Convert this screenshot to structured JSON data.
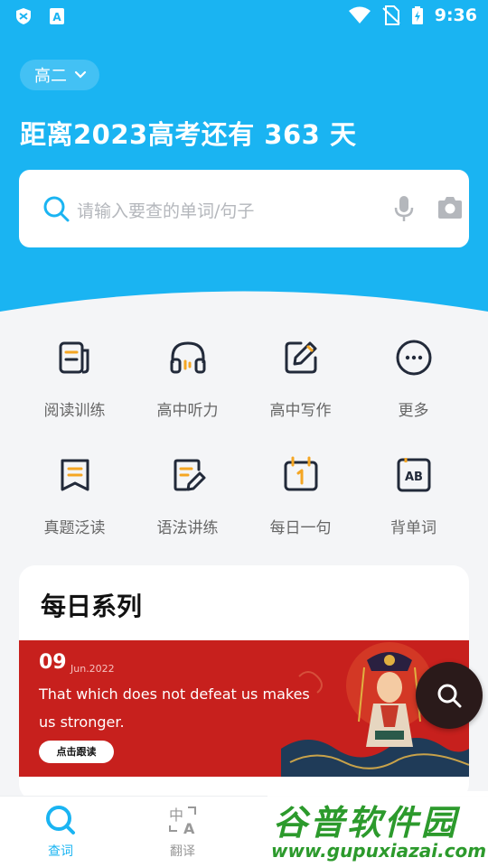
{
  "status_bar": {
    "time": "9:36"
  },
  "header": {
    "grade": "高二",
    "countdown": "距离2023高考还有 363 天"
  },
  "search": {
    "placeholder": "请输入要查的单词/句子"
  },
  "features": [
    {
      "label": "阅读训练",
      "icon": "reading-icon"
    },
    {
      "label": "高中听力",
      "icon": "headphones-icon"
    },
    {
      "label": "高中写作",
      "icon": "writing-icon"
    },
    {
      "label": "更多",
      "icon": "more-icon"
    },
    {
      "label": "真题泛读",
      "icon": "bookmark-icon"
    },
    {
      "label": "语法讲练",
      "icon": "grammar-icon"
    },
    {
      "label": "每日一句",
      "icon": "calendar-icon"
    },
    {
      "label": "背单词",
      "icon": "word-card-icon"
    }
  ],
  "daily": {
    "title": "每日系列",
    "day": "09",
    "month": "Jun.2022",
    "sentence": "That which does not defeat us makes us stronger.",
    "button": "点击跟读"
  },
  "tabs": [
    {
      "label": "查词",
      "icon": "search-icon",
      "active": true
    },
    {
      "label": "翻译",
      "icon": "translate-icon",
      "active": false
    }
  ],
  "watermark": {
    "line1": "谷普软件园",
    "line2": "www.gupuxiazai.com"
  },
  "colors": {
    "accent": "#1ab4f2",
    "icon_dark": "#222a3a",
    "icon_accent": "#f5a623",
    "banner": "#c7201d"
  }
}
